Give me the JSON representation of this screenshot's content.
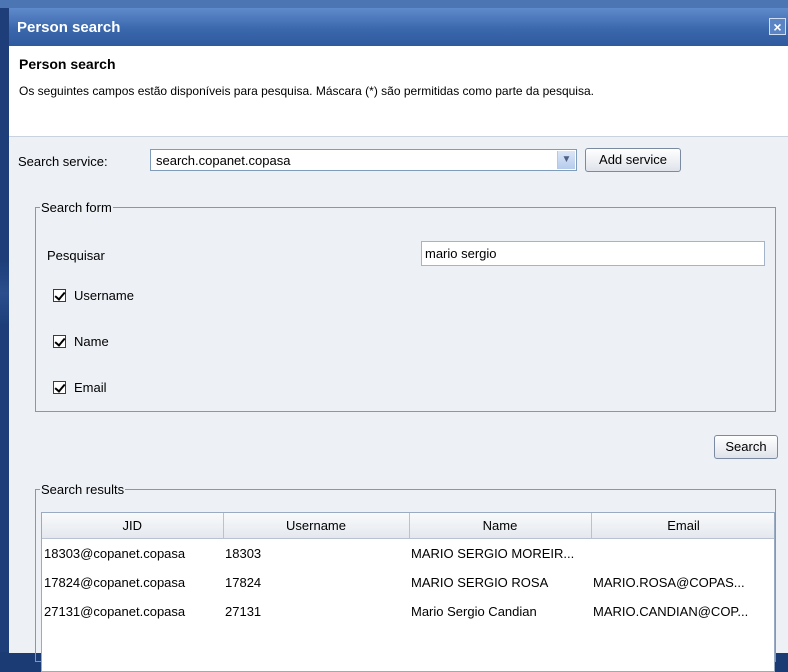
{
  "window": {
    "title": "Person search",
    "close_glyph": "×"
  },
  "header": {
    "title": "Person search",
    "description": "Os seguintes campos estão disponíveis para pesquisa. Máscara (*) são permitidas como parte da pesquisa."
  },
  "service": {
    "label": "Search service:",
    "selected": "search.copanet.copasa",
    "add_button": "Add service"
  },
  "search_form": {
    "legend": "Search form",
    "query_label": "Pesquisar",
    "query_value": "mario sergio",
    "checkboxes": [
      {
        "label": "Username",
        "checked": true
      },
      {
        "label": "Name",
        "checked": true
      },
      {
        "label": "Email",
        "checked": true
      }
    ]
  },
  "search_button": "Search",
  "results": {
    "legend": "Search results",
    "columns": [
      "JID",
      "Username",
      "Name",
      "Email"
    ],
    "rows": [
      [
        "18303@copanet.copasa",
        "18303",
        "MARIO SERGIO MOREIR...",
        ""
      ],
      [
        "17824@copanet.copasa",
        "17824",
        "MARIO SERGIO ROSA",
        "MARIO.ROSA@COPAS..."
      ],
      [
        "27131@copanet.copasa",
        "27131",
        "Mario Sergio Candian",
        "MARIO.CANDIAN@COP..."
      ]
    ]
  }
}
